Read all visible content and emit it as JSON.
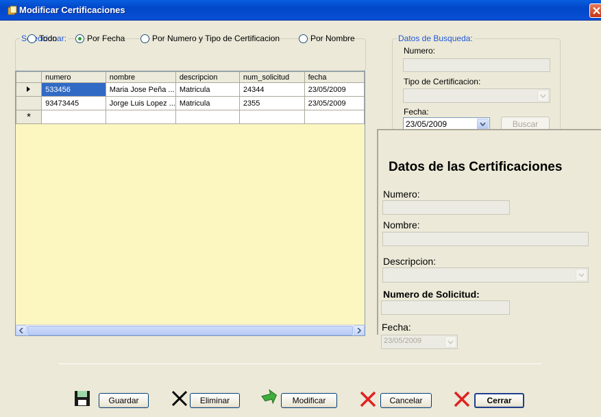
{
  "window": {
    "title": "Modificar Certificaciones"
  },
  "seleccionar": {
    "legend": "Seleccionar:",
    "options": [
      {
        "label": "Todo",
        "checked": false
      },
      {
        "label": "Por Fecha",
        "checked": true
      },
      {
        "label": "Por Numero y Tipo de Certificacion",
        "checked": false
      },
      {
        "label": "Por Nombre",
        "checked": false
      }
    ]
  },
  "busqueda": {
    "legend": "Datos de Busqueda:",
    "numero_label": "Numero:",
    "numero_value": "",
    "tipo_label": "Tipo de Certificacion:",
    "tipo_value": "",
    "fecha_label": "Fecha:",
    "fecha_value": "23/05/2009",
    "buscar_label": "Buscar"
  },
  "grid": {
    "columns": [
      "numero",
      "nombre",
      "descripcion",
      "num_solicitud",
      "fecha"
    ],
    "rows": [
      {
        "numero": "533456",
        "nombre": "Maria Jose Peña ...",
        "descripcion": "Matricula",
        "num_solicitud": "24344",
        "fecha": "23/05/2009"
      },
      {
        "numero": "93473445",
        "nombre": "Jorge Luis Lopez ...",
        "descripcion": "Matricula",
        "num_solicitud": "2355",
        "fecha": "23/05/2009"
      }
    ],
    "new_row_marker": "*"
  },
  "detalle": {
    "title": "Datos de las Certificaciones",
    "numero_label": "Numero:",
    "nombre_label": "Nombre:",
    "descripcion_label": "Descripcion:",
    "solicitud_label": "Numero de Solicitud:",
    "fecha_label": "Fecha:",
    "fecha_value": "23/05/2009"
  },
  "toolbar": {
    "guardar": "Guardar",
    "eliminar": "Eliminar",
    "modificar": "Modificar",
    "cancelar": "Cancelar",
    "cerrar": "Cerrar"
  },
  "colors": {
    "title_bar": "#0a4fd6",
    "grid_background": "#fcf7c0",
    "selection": "#316ac5",
    "legend_text": "#1f57d6"
  }
}
